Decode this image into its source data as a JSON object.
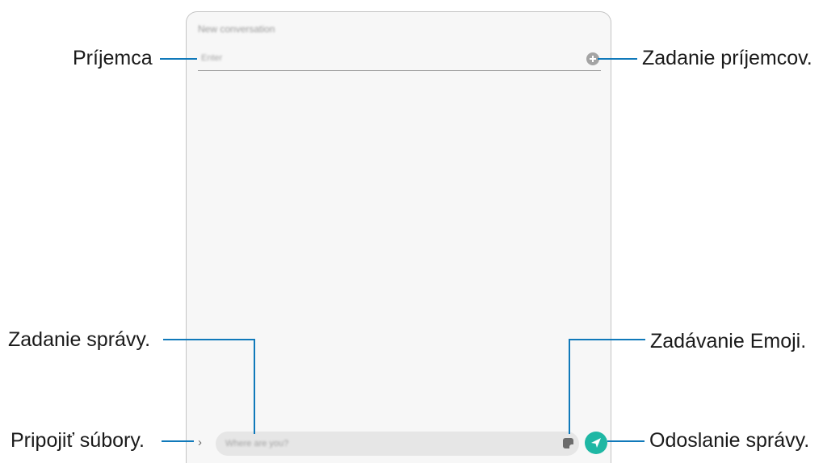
{
  "screen": {
    "title": "New conversation",
    "recipient_placeholder": "Enter",
    "message_placeholder": "Where are you?"
  },
  "callouts": {
    "recipient": "Príjemca",
    "add_recipients": "Zadanie príjemcov.",
    "enter_message": "Zadanie správy.",
    "enter_emoji": "Zadávanie Emoji.",
    "attach_files": "Pripojiť súbory.",
    "send_message": "Odoslanie správy."
  },
  "icons": {
    "add": "add-recipient-icon",
    "expand": "expand-arrow-icon",
    "emoji": "sticker-icon",
    "send": "send-icon"
  },
  "colors": {
    "callout_line": "#1079ba",
    "send_button": "#1fb7a4"
  }
}
